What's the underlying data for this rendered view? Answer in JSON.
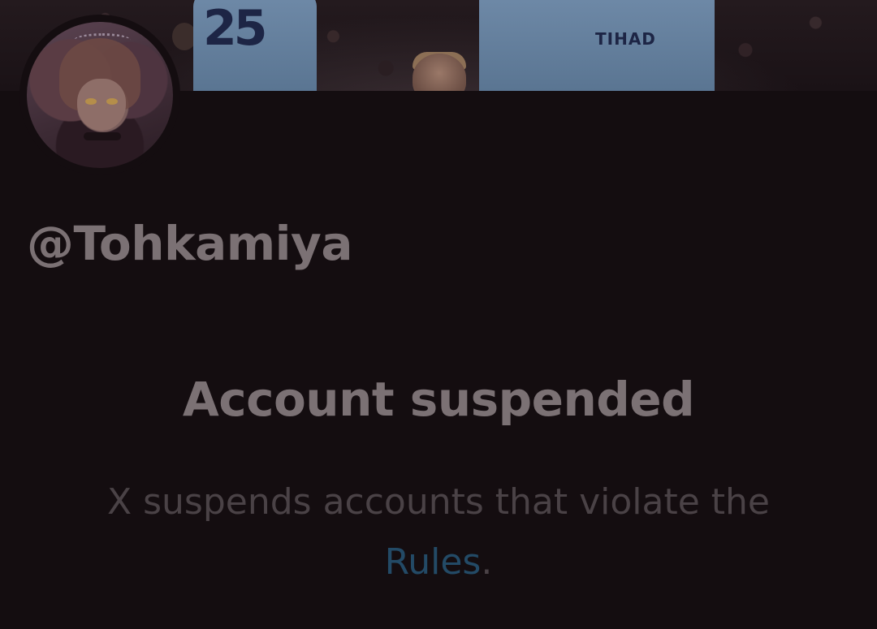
{
  "profile": {
    "username": "@Tohkamiya"
  },
  "banner": {
    "jersey_number": "25",
    "sponsor_text": "TIHAD"
  },
  "suspension": {
    "title": "Account suspended",
    "description": "X suspends accounts that violate the",
    "link_text": "Rules",
    "trailing_punctuation": "."
  },
  "colors": {
    "background": "#140d10",
    "text_primary": "#7b7174",
    "text_secondary": "#4a4246",
    "link": "#234a66"
  }
}
